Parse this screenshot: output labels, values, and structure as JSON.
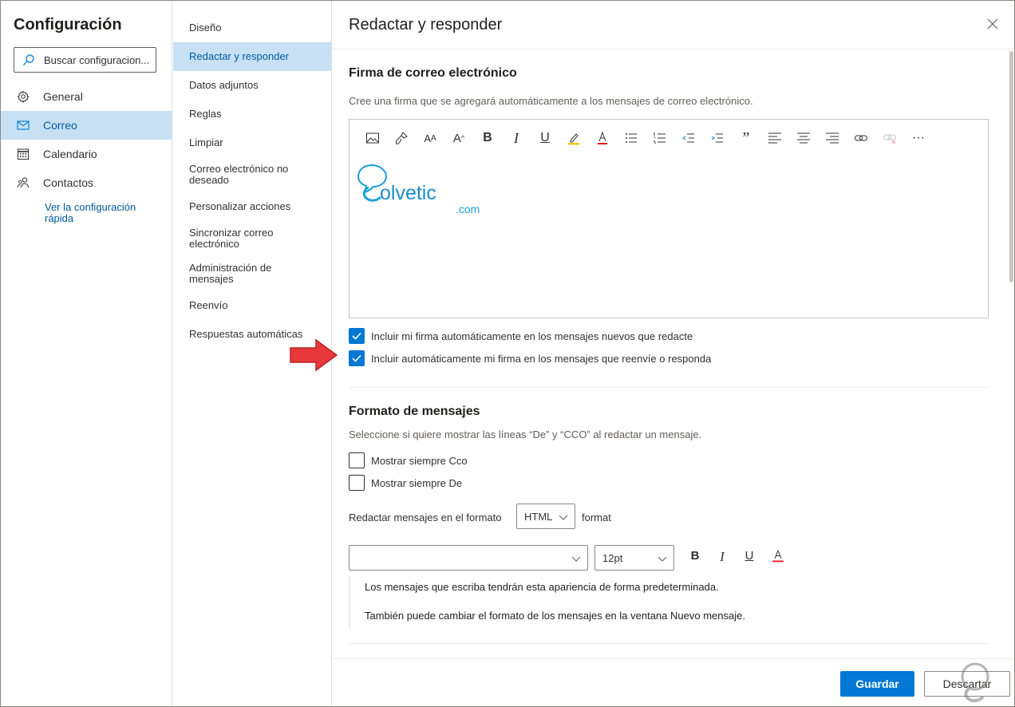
{
  "sidebar": {
    "title": "Configuración",
    "search_placeholder": "Buscar configuracion...",
    "items": [
      {
        "label": "General",
        "icon": "gear-icon"
      },
      {
        "label": "Correo",
        "icon": "mail-icon",
        "active": true
      },
      {
        "label": "Calendario",
        "icon": "calendar-icon"
      },
      {
        "label": "Contactos",
        "icon": "people-icon"
      }
    ],
    "quick_link": "Ver la configuración rápida"
  },
  "subnav": {
    "items": [
      {
        "label": "Diseño"
      },
      {
        "label": "Redactar y responder",
        "active": true
      },
      {
        "label": "Datos adjuntos"
      },
      {
        "label": "Reglas"
      },
      {
        "label": "Limpiar"
      },
      {
        "label": "Correo electrónico no deseado"
      },
      {
        "label": "Personalizar acciones"
      },
      {
        "label": "Sincronizar correo electrónico"
      },
      {
        "label": "Administración de mensajes"
      },
      {
        "label": "Reenvío"
      },
      {
        "label": "Respuestas automáticas"
      }
    ]
  },
  "panel": {
    "title": "Redactar y responder",
    "signature": {
      "heading": "Firma de correo electrónico",
      "description": "Cree una firma que se agregará automáticamente a los mensajes de correo electrónico.",
      "toolbar": [
        "image-icon",
        "format-painter-icon",
        "font-size-icon",
        "grow-font-icon",
        "bold-icon",
        "italic-icon",
        "underline-icon",
        "highlight-icon",
        "font-color-icon",
        "bullets-icon",
        "numbering-icon",
        "decrease-indent-icon",
        "increase-indent-icon",
        "quote-icon",
        "align-left-icon",
        "align-center-icon",
        "align-right-icon",
        "link-icon",
        "unlink-icon",
        "more-icon"
      ],
      "logo_text": "olvetic",
      "logo_suffix": ".com",
      "check_new": "Incluir mi firma automáticamente en los mensajes nuevos que redacte",
      "check_reply": "Incluir automáticamente mi firma en los mensajes que reenvíe o responda",
      "check_new_checked": true,
      "check_reply_checked": true
    },
    "format": {
      "heading": "Formato de mensajes",
      "description": "Seleccione si quiere mostrar las líneas “De” y “CCO” al redactar un mensaje.",
      "always_bcc": "Mostrar siempre Cco",
      "always_from": "Mostrar siempre De",
      "compose_label": "Redactar mensajes en el formato",
      "compose_value": "HTML",
      "compose_suffix": "format",
      "font_value": "",
      "size_value": "12pt",
      "preview_line1": "Los mensajes que escriba tendrán esta apariencia de forma predeterminada.",
      "preview_line2": "También puede cambiar el formato de los mensajes en la ventana Nuevo mensaje."
    },
    "buttons": {
      "save": "Guardar",
      "discard": "Descartar"
    }
  },
  "colors": {
    "accent": "#0078d4",
    "selected_bg": "#c7e0f4",
    "arrow": "#e8383b"
  }
}
